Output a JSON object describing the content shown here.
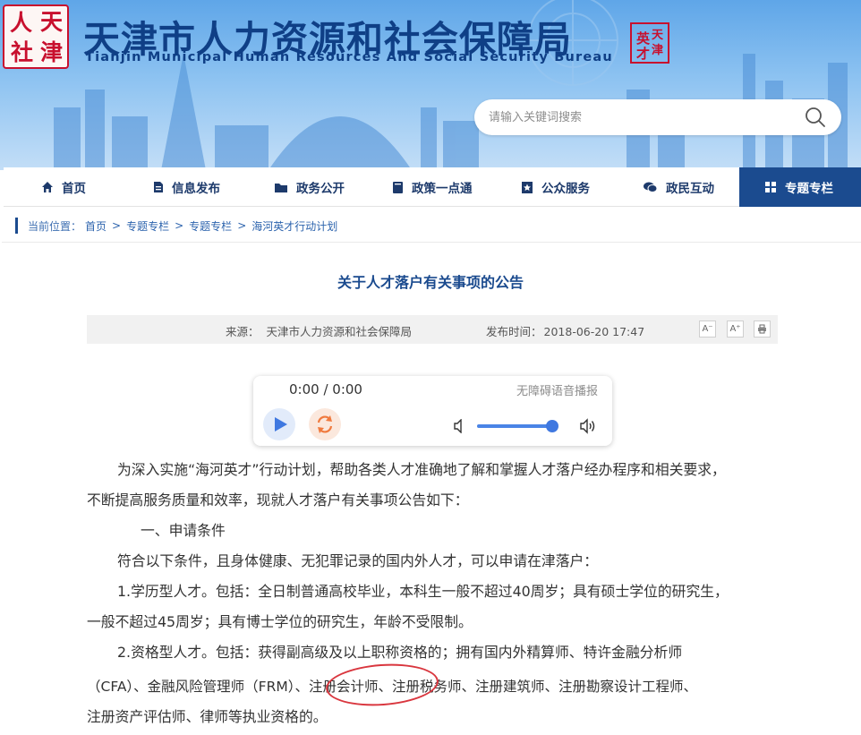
{
  "header": {
    "logo_chars": [
      "人",
      "天",
      "社",
      "津"
    ],
    "title": "天津市人力资源和社会保障局",
    "subtitle": "Tianjin Municipal Human Resources And Social Security Bureau",
    "stamp_chars": [
      "天",
      "津",
      "英",
      "才"
    ],
    "search_placeholder": "请输入关键词搜索"
  },
  "nav": {
    "items": [
      {
        "label": "首页",
        "icon": "home-icon"
      },
      {
        "label": "信息发布",
        "icon": "document-icon"
      },
      {
        "label": "政务公开",
        "icon": "folder-icon"
      },
      {
        "label": "政策一点通",
        "icon": "book-icon"
      },
      {
        "label": "公众服务",
        "icon": "star-badge-icon"
      },
      {
        "label": "政民互动",
        "icon": "chat-icon"
      },
      {
        "label": "专题专栏",
        "icon": "grid-icon",
        "active": true
      }
    ]
  },
  "breadcrumb": {
    "label": "当前位置：",
    "items": [
      "首页",
      "专题专栏",
      "专题专栏",
      "海河英才行动计划"
    ],
    "separator": ">"
  },
  "article": {
    "title": "关于人才落户有关事项的公告",
    "source_label": "来源：",
    "source": "天津市人力资源和社会保障局",
    "time_label": "发布时间：",
    "time": "2018-06-20 17:47",
    "tools": [
      "A⁻",
      "A⁺",
      "print"
    ],
    "paragraphs": [
      "为深入实施“海河英才”行动计划，帮助各类人才准确地了解和掌握人才落户经办程序和相关要求，",
      "不断提高服务质量和效率，现就人才落户有关事项公告如下：",
      "一、申请条件",
      "符合以下条件，且身体健康、无犯罪记录的国内外人才，可以申请在津落户：",
      "1.学历型人才。包括：全日制普通高校毕业，本科生一般不超过40周岁；具有硕士学位的研究生，",
      "一般不超过45周岁；具有博士学位的研究生，年龄不受限制。",
      "2.资格型人才。包括：获得副高级及以上职称资格的；拥有国内外精算师、特许金融分析师",
      "（CFA）、金融风险管理师（FRM）、注册会计师、注册税务师、注册建筑师、注册勘察设计工程师、",
      "注册资产评估师、律师等执业资格的。"
    ]
  },
  "player": {
    "time": "0:00 / 0:00",
    "tts_label": "无障碍语音播报",
    "volume": 0.93
  },
  "colors": {
    "brand_blue": "#1b4b8f",
    "title_blue": "#0f3f86",
    "highlight_red": "#d9363e"
  }
}
